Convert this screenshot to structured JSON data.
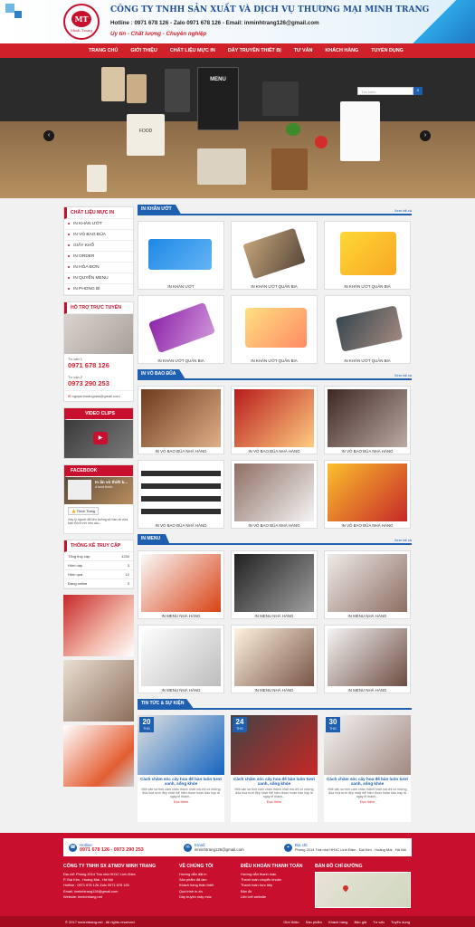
{
  "header": {
    "logo_text": "MT",
    "logo_name": "Minh Trang",
    "company": "CÔNG TY TNHH SẢN XUẤT VÀ DỊCH VỤ THƯƠNG MẠI MINH TRANG",
    "contact": "Hotline : 0971 678 126 - Zalo 0971 678 126 - Email: inminhtrang126@gmail.com",
    "slogan": "Uy tín - Chất lượng - Chuyên nghiệp"
  },
  "nav": [
    "TRANG CHỦ",
    "GIỚI THIỆU",
    "CHẤT LIỆU MỰC IN",
    "DÂY TRUYỀN THIẾT BỊ",
    "TƯ VẤN",
    "KHÁCH HÀNG",
    "TUYỂN DỤNG"
  ],
  "search": {
    "placeholder": "Tìm kiếm"
  },
  "banner": {
    "menu": "MENU",
    "food": "FOOD"
  },
  "sidebar": {
    "categories_title": "CHẤT LIỆU MỰC IN",
    "categories": [
      "IN KHĂN ƯỚT",
      "IN VỎ BAO ĐŨA",
      "GIẤY KHỔ",
      "IN ORDER",
      "IN HÓA ĐƠN",
      "IN QUYỂN MENU",
      "IN PHONG BÌ"
    ],
    "support_title": "HỖ TRỢ TRỰC TUYẾN",
    "support1_label": "Tư vấn 1",
    "support1_phone": "0971 678 126",
    "support2_label": "Tư vấn 2",
    "support2_phone": "0973 290 253",
    "support_email": "nguyenhoangnea@gmail.com",
    "video_title": "VIDEO CLIPS",
    "facebook_title": "FACEBOOK",
    "fb_page": "In ấn vỏ thiết k...",
    "fb_likes": "4 lượt thích",
    "fb_button": "Thích Trang",
    "fb_post": "Xây lý người đã liên tưởng sẽ bạn về nhà bạn thích với nhu cầu...",
    "stats_title": "THỐNG KÊ TRUY CẬP",
    "stats": [
      {
        "label": "Tổng truy cập",
        "value": "1234"
      },
      {
        "label": "Hôm nay",
        "value": "3"
      },
      {
        "label": "Hôm qua",
        "value": "12"
      },
      {
        "label": "Đang online",
        "value": "3"
      }
    ]
  },
  "sections": [
    {
      "title": "IN KHĂN ƯỚT",
      "more": "Xem tất cả",
      "items": [
        "IN KHĂN ƯỚT",
        "IN KHĂN ƯỚT QUẢN BIA",
        "IN KHĂN ƯỚT QUẢN BIA",
        "IN KHĂN ƯỚT QUẢN BIA",
        "IN KHĂN ƯỚT QUẢN BIA",
        "IN KHĂN ƯỚT QUẢN BIA"
      ]
    },
    {
      "title": "IN VỎ BAO ĐŨA",
      "more": "Xem tất cả",
      "items": [
        "IN VỎ BAO ĐŨA NHÀ HÀNG",
        "IN VỎ BAO ĐŨA NHÀ HÀNG",
        "IN VỎ BAO ĐŨA NHÀ HÀNG",
        "IN VỎ BAO ĐŨA NHÀ HÀNG",
        "IN VỎ BAO ĐŨA NHÀ HÀNG",
        "IN VỎ BAO ĐŨA NHÀ HÀNG"
      ]
    },
    {
      "title": "IN MENU",
      "more": "Xem tất cả",
      "items": [
        "IN MENU NHÀ HÀNG",
        "IN MENU NHÀ HÀNG",
        "IN MENU NHÀ HÀNG",
        "IN MENU NHÀ HÀNG",
        "IN MENU NHÀ HÀNG",
        "IN MENU NHÀ HÀNG"
      ]
    }
  ],
  "news": {
    "title": "TIN TỨC & SỰ KIỆN",
    "items": [
      {
        "day": "20",
        "month": "THG",
        "title": "Cách chăm sóc cây hoa để bàn luôn tươi xanh, sống khỏe",
        "desc": "Một văn sơ tinh cảm chân thành nhất mà chỉ có những đóa hoa tươi đẹp nhất thể hiện được hoàn hảo hay là ngày lễ thành...",
        "more": "Đọc thêm"
      },
      {
        "day": "24",
        "month": "THG",
        "title": "Cách chăm sóc cây hoa để bàn luôn tươi xanh, sống khỏe",
        "desc": "Một văn sơ tinh cảm chân thành nhất mà chỉ có những đóa hoa tươi đẹp nhất thể hiện được hoàn hảo hay là ngày lễ thành...",
        "more": "Đọc thêm"
      },
      {
        "day": "30",
        "month": "THG",
        "title": "Cách chăm sóc cây hoa để bàn luôn tươi xanh, sống khỏe",
        "desc": "Một văn sơ tinh cảm chân thành nhất mà chỉ có những đóa hoa tươi đẹp nhất thể hiện được hoàn hảo hay là ngày lễ thành...",
        "more": "Đọc thêm"
      }
    ]
  },
  "footer": {
    "hotline_label": "Hotline:",
    "hotline": "0971 678 126 - 0973 290 253",
    "email_label": "Email:",
    "email": "inminhtrang126@gmail.com",
    "address_label": "Địa chỉ:",
    "address": "Phòng 2014 Tòa nhà HH1C Linh Đàm , Đại Kim , Hoàng Mai , Hà Nội",
    "company_title": "CÔNG TY TNHH SX &TMDV MINH TRANG",
    "company_lines": [
      "Địa chỉ: Phòng 2014 Tòa nhà HH1C Linh Đàm",
      "P. Đại Kim , Hoàng Mai , Hà Nội",
      "Hotline : 0971 678 126 Zalo 0971 678 126",
      "Email: inminhtrang126@gmail.com",
      "Website: inminhtrang.net"
    ],
    "about_title": "VỀ CHÚNG TÔI",
    "about_links": [
      "Hướng dẫn đặt in",
      "Sản phẩm đã làm",
      "Khách hàng thân thiết",
      "Quá trình in ấn",
      "Dây truyền máy móc"
    ],
    "terms_title": "ĐIỀU KHOẢN THANH TOÁN",
    "terms_links": [
      "Hướng dẫn thanh toán",
      "Thanh toán chuyển khoản",
      "Thanh toán trực tiếp",
      "Bản đồ",
      "Liên kết website"
    ],
    "map_title": "BẢN ĐỒ CHỈ ĐƯỜNG",
    "copyright": "© 2017 inminhtrang.net . All rights reserved",
    "bottom_links": [
      "Giới thiệu",
      "Sản phẩm",
      "Khách hàng",
      "Bảo giá",
      "Tư vấn",
      "Tuyển dụng"
    ]
  }
}
